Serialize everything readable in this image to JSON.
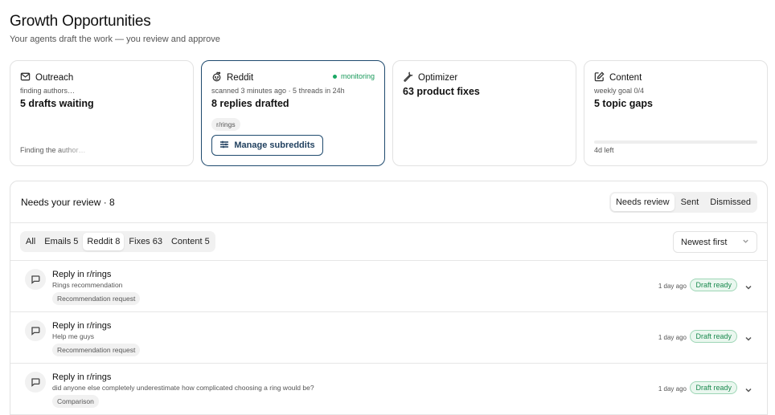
{
  "header": {
    "title": "Growth Opportunities",
    "subtitle": "Your agents draft the work — you review and approve"
  },
  "cards": {
    "outreach": {
      "title": "Outreach",
      "status": "finding authors…",
      "main": "5 drafts waiting",
      "footer": "Finding the author…",
      "icon": "mail-icon"
    },
    "reddit": {
      "title": "Reddit",
      "badge": "monitoring",
      "status": "scanned 3 minutes ago · 5 threads in 24h",
      "main": "8 replies drafted",
      "tag": "r/rings",
      "button": "Manage subreddits",
      "icon": "reddit-icon",
      "accent": "#1f4a6e",
      "badge_color": "#1a9a5b"
    },
    "optimizer": {
      "title": "Optimizer",
      "main": "63 product fixes",
      "icon": "wrench-icon"
    },
    "content": {
      "title": "Content",
      "status": "weekly goal 0/4",
      "main": "5 topic gaps",
      "footer": "4d left",
      "progress": 0,
      "icon": "edit-icon"
    }
  },
  "review": {
    "title": "Needs your review · 8",
    "views": [
      "Needs review",
      "Sent",
      "Dismissed"
    ],
    "selected_view": "Needs review",
    "filters": [
      "All",
      "Emails 5",
      "Reddit 8",
      "Fixes 63",
      "Content 5"
    ],
    "selected_filter": "Reddit 8",
    "sort": "Newest first",
    "items": [
      {
        "title": "Reply in r/rings",
        "subtitle": "Rings recommendation",
        "tag": "Recommendation request",
        "time": "1 day ago",
        "status": "Draft ready"
      },
      {
        "title": "Reply in r/rings",
        "subtitle": "Help me guys",
        "tag": "Recommendation request",
        "time": "1 day ago",
        "status": "Draft ready"
      },
      {
        "title": "Reply in r/rings",
        "subtitle": "did anyone else completely underestimate how complicated choosing a ring would be?",
        "tag": "Comparison",
        "time": "1 day ago",
        "status": "Draft ready"
      }
    ]
  }
}
